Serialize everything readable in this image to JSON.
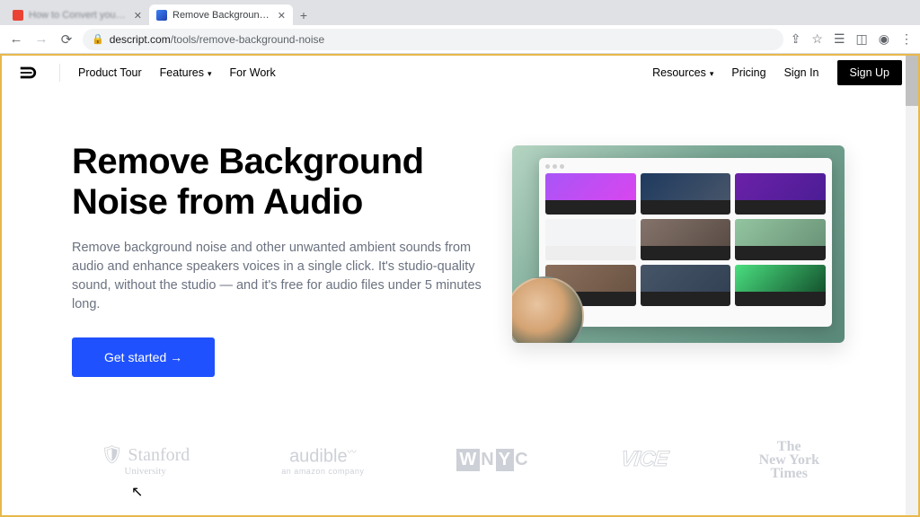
{
  "browser": {
    "tabs": [
      {
        "title": "How to Convert your PDF file in ...",
        "active": false
      },
      {
        "title": "Remove Background Noise from...",
        "active": true
      }
    ],
    "url_host": "descript.com",
    "url_path": "/tools/remove-background-noise"
  },
  "nav": {
    "product_tour": "Product Tour",
    "features": "Features",
    "for_work": "For Work",
    "resources": "Resources",
    "pricing": "Pricing",
    "sign_in": "Sign In",
    "sign_up": "Sign Up"
  },
  "hero": {
    "title": "Remove Background Noise from Audio",
    "description": "Remove background noise and other unwanted ambient sounds from audio and enhance speakers voices in a single click. It's studio-quality sound, without the studio — and it's free for audio files under 5 minutes long.",
    "cta": "Get started →"
  },
  "logos": {
    "stanford": "Stanford",
    "stanford_sub": "University",
    "audible": "audible",
    "audible_sub": "an amazon company",
    "wnyc_1": "W",
    "wnyc_2": "N",
    "wnyc_3": "Y",
    "wnyc_4": "C",
    "vice": "VICE",
    "nyt_1": "The",
    "nyt_2": "New York",
    "nyt_3": "Times"
  }
}
